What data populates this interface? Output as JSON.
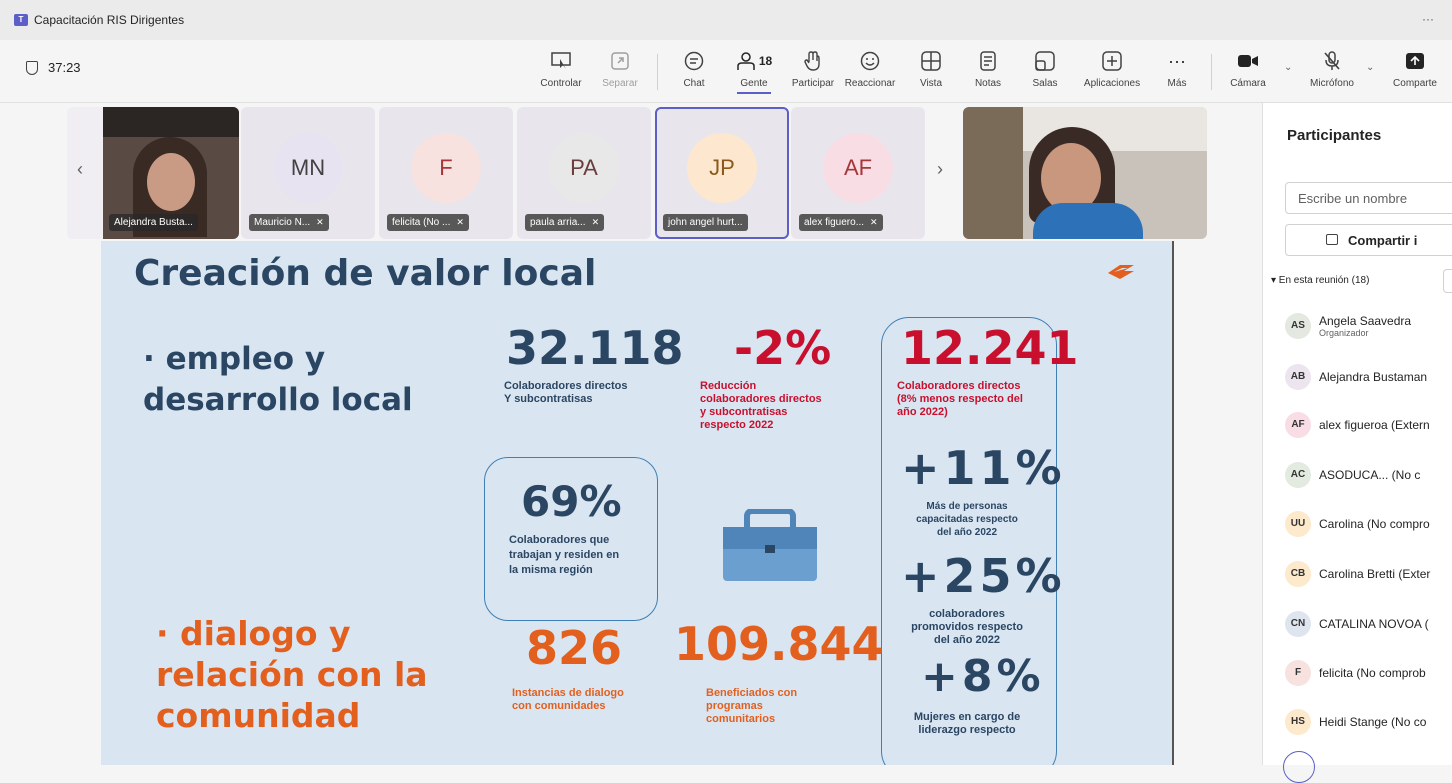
{
  "window": {
    "title": "Capacitación RIS Dirigentes",
    "menu": "···",
    "app_badge": "T"
  },
  "meeting": {
    "elapsed": "37:23"
  },
  "toolbar": {
    "controlar": "Controlar",
    "separar": "Separar",
    "chat": "Chat",
    "gente": "Gente",
    "people_count": "18",
    "participar": "Participar",
    "reaccionar": "Reaccionar",
    "vista": "Vista",
    "notas": "Notas",
    "salas": "Salas",
    "aplicaciones": "Aplicaciones",
    "mas": "Más",
    "camara": "Cámara",
    "microfono": "Micrófono",
    "comparte": "Comparte"
  },
  "video_strip": [
    {
      "name": "Alejandra Busta...",
      "initials": "",
      "video": true
    },
    {
      "name": "Mauricio N...",
      "initials": "MN",
      "color": "#e7e3f1"
    },
    {
      "name": "felicita (No ...",
      "initials": "F",
      "color": "#f7e2df"
    },
    {
      "name": "paula arria...",
      "initials": "PA",
      "color": "#e8e8e8"
    },
    {
      "name": "john angel hurt...",
      "initials": "JP",
      "color": "#fde7cf"
    },
    {
      "name": "alex figuero...",
      "initials": "AF",
      "color": "#f8dde5"
    }
  ],
  "slide": {
    "title": "Creación de valor local",
    "bullet1_line1": "· empleo y",
    "bullet1_line2": "desarrollo local",
    "bullet2_line1": "· dialogo y",
    "bullet2_line2": "relación con la",
    "bullet2_line3": "comunidad",
    "stat1_value": "32.118",
    "stat1_line1": "Colaboradores directos",
    "stat1_line2": "Y subcontratisas",
    "stat2_value": "-2%",
    "stat2_line1": "Reducción",
    "stat2_line2": "colaboradores directos",
    "stat2_line3": "y subcontratisas",
    "stat2_line4": "respecto 2022",
    "stat3_value": "69%",
    "stat3_line1": "Colaboradores que",
    "stat3_line2": "trabajan y residen en",
    "stat3_line3": "la misma región",
    "stat4_value": "12.241",
    "stat4_line1": "Colaboradores  directos",
    "stat4_line2": "(8% menos respecto del",
    "stat4_line3": "año 2022)",
    "stat5_value": "+11%",
    "stat5_line1": "Más de personas",
    "stat5_line2": "capacitadas respecto",
    "stat5_line3": "del año 2022",
    "stat6_value": "+25%",
    "stat6_line1": "colaboradores",
    "stat6_line2": "promovidos respecto",
    "stat6_line3": "del año 2022",
    "stat7_value": "+8%",
    "stat7_line1": "Mujeres en cargo de",
    "stat7_line2": "liderazgo respecto",
    "stat8_value": "826",
    "stat8_line1": "Instancias de dialogo",
    "stat8_line2": "con comunidades",
    "stat9_value": "109.844",
    "stat9_line1": "Beneficiados con",
    "stat9_line2": "programas",
    "stat9_line3": "comunitarios"
  },
  "participants_panel": {
    "title": "Participantes",
    "search_placeholder": "Escribe un nombre",
    "share_label": "Compartir i",
    "section_label": "▾ En esta reunión (18)",
    "people": [
      {
        "initials": "AS",
        "name": "Angela Saavedra",
        "role": "Organizador",
        "color": "#e3e8e1"
      },
      {
        "initials": "AB",
        "name": "Alejandra Bustaman",
        "color": "#ece4ef"
      },
      {
        "initials": "AF",
        "name": "alex figueroa (Extern",
        "color": "#f8dde5"
      },
      {
        "initials": "AC",
        "name": "ASODUCA...  (No c",
        "color": "#e3eadf"
      },
      {
        "initials": "UU",
        "name": "Carolina (No compro",
        "color": "#fde9cc"
      },
      {
        "initials": "CB",
        "name": "Carolina Bretti (Exter",
        "color": "#fde9cc"
      },
      {
        "initials": "CN",
        "name": "CATALINA NOVOA (",
        "color": "#dfe5ef"
      },
      {
        "initials": "F",
        "name": "felicita (No comprob",
        "color": "#f7e2df"
      },
      {
        "initials": "HS",
        "name": "Heidi Stange (No co",
        "color": "#fde9cc"
      }
    ]
  }
}
